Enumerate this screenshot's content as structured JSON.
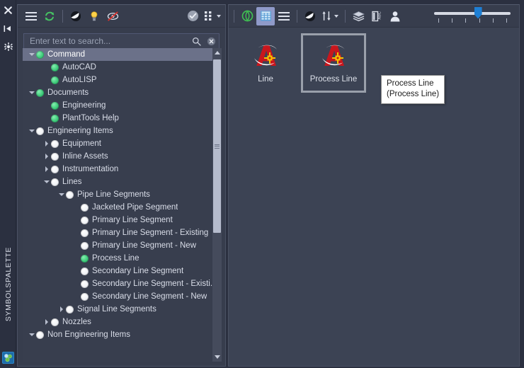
{
  "dock": {
    "title": "SYMBOLSPALETTE",
    "icons": [
      {
        "name": "close-icon",
        "glyph": "close"
      },
      {
        "name": "auto-hide-pin-icon",
        "glyph": "pin"
      },
      {
        "name": "settings-gear-icon",
        "glyph": "gear"
      }
    ],
    "bottom_icon": "symbol-palette-icon"
  },
  "palette": {
    "toolbar": {
      "menu_label": "Menu",
      "refresh_label": "Refresh",
      "contrast_label": "Contrast",
      "lightbulb_label": "Highlight",
      "no_preview_label": "Disable Preview",
      "check_label": "Apply",
      "grid_label": "View Options",
      "dropdown_label": "More"
    },
    "search": {
      "placeholder": "Enter text to search...",
      "value": "",
      "search_icon": "search-icon",
      "clear_icon": "clear-icon"
    }
  },
  "tree": {
    "selected": "Command",
    "scroll": {
      "up_label": "Scroll Up",
      "down_label": "Scroll Down"
    },
    "rows": [
      {
        "label": "Command",
        "indent": 0,
        "twisty": "down",
        "bullet": "green",
        "selected": true
      },
      {
        "label": "AutoCAD",
        "indent": 1,
        "twisty": "none",
        "bullet": "green",
        "selected": false
      },
      {
        "label": "AutoLISP",
        "indent": 1,
        "twisty": "none",
        "bullet": "green",
        "selected": false
      },
      {
        "label": "Documents",
        "indent": 0,
        "twisty": "down",
        "bullet": "green",
        "selected": false
      },
      {
        "label": "Engineering",
        "indent": 1,
        "twisty": "none",
        "bullet": "green",
        "selected": false
      },
      {
        "label": "PlantTools Help",
        "indent": 1,
        "twisty": "none",
        "bullet": "green",
        "selected": false
      },
      {
        "label": "Engineering Items",
        "indent": 0,
        "twisty": "down",
        "bullet": "white",
        "selected": false
      },
      {
        "label": "Equipment",
        "indent": 1,
        "twisty": "right",
        "bullet": "white",
        "selected": false
      },
      {
        "label": "Inline Assets",
        "indent": 1,
        "twisty": "right",
        "bullet": "white",
        "selected": false
      },
      {
        "label": "Instrumentation",
        "indent": 1,
        "twisty": "right",
        "bullet": "white",
        "selected": false
      },
      {
        "label": "Lines",
        "indent": 1,
        "twisty": "down",
        "bullet": "white",
        "selected": false
      },
      {
        "label": "Pipe Line Segments",
        "indent": 2,
        "twisty": "down",
        "bullet": "white",
        "selected": false
      },
      {
        "label": "Jacketed Pipe Segment",
        "indent": 3,
        "twisty": "none",
        "bullet": "white",
        "selected": false
      },
      {
        "label": "Primary Line Segment",
        "indent": 3,
        "twisty": "none",
        "bullet": "white",
        "selected": false
      },
      {
        "label": "Primary Line Segment - Existing",
        "indent": 3,
        "twisty": "none",
        "bullet": "white",
        "selected": false
      },
      {
        "label": "Primary Line Segment - New",
        "indent": 3,
        "twisty": "none",
        "bullet": "white",
        "selected": false
      },
      {
        "label": "Process Line",
        "indent": 3,
        "twisty": "none",
        "bullet": "green",
        "selected": false
      },
      {
        "label": "Secondary Line Segment",
        "indent": 3,
        "twisty": "none",
        "bullet": "white",
        "selected": false
      },
      {
        "label": "Secondary Line Segment - Existi...",
        "indent": 3,
        "twisty": "none",
        "bullet": "white",
        "selected": false
      },
      {
        "label": "Secondary Line Segment - New",
        "indent": 3,
        "twisty": "none",
        "bullet": "white",
        "selected": false
      },
      {
        "label": "Signal Line Segments",
        "indent": 2,
        "twisty": "right",
        "bullet": "white",
        "selected": false
      },
      {
        "label": "Nozzles",
        "indent": 1,
        "twisty": "right",
        "bullet": "white",
        "selected": false
      },
      {
        "label": "Non Engineering Items",
        "indent": 0,
        "twisty": "down",
        "bullet": "white",
        "selected": false
      }
    ]
  },
  "rightpanel": {
    "toolbar": {
      "globe_label": "Scope",
      "grid_view_label": "Grid View",
      "list_view_label": "List View",
      "contrast_label": "Contrast",
      "sort_label": "Sort",
      "sort_dropdown_label": "Sort Options",
      "layers_label": "Layers",
      "abc_label": "Labels",
      "user_label": "User"
    },
    "slider": {
      "value": 4,
      "min": 1,
      "max": 6,
      "ticks": 6,
      "label": "Icon Size"
    },
    "symbols": [
      {
        "label": "Line",
        "icon": "autocad-logo-icon",
        "selected": false
      },
      {
        "label": "Process Line",
        "icon": "autocad-logo-icon",
        "selected": true
      }
    ],
    "tooltip": {
      "line1": "Process Line",
      "line2": "(Process Line)"
    }
  }
}
